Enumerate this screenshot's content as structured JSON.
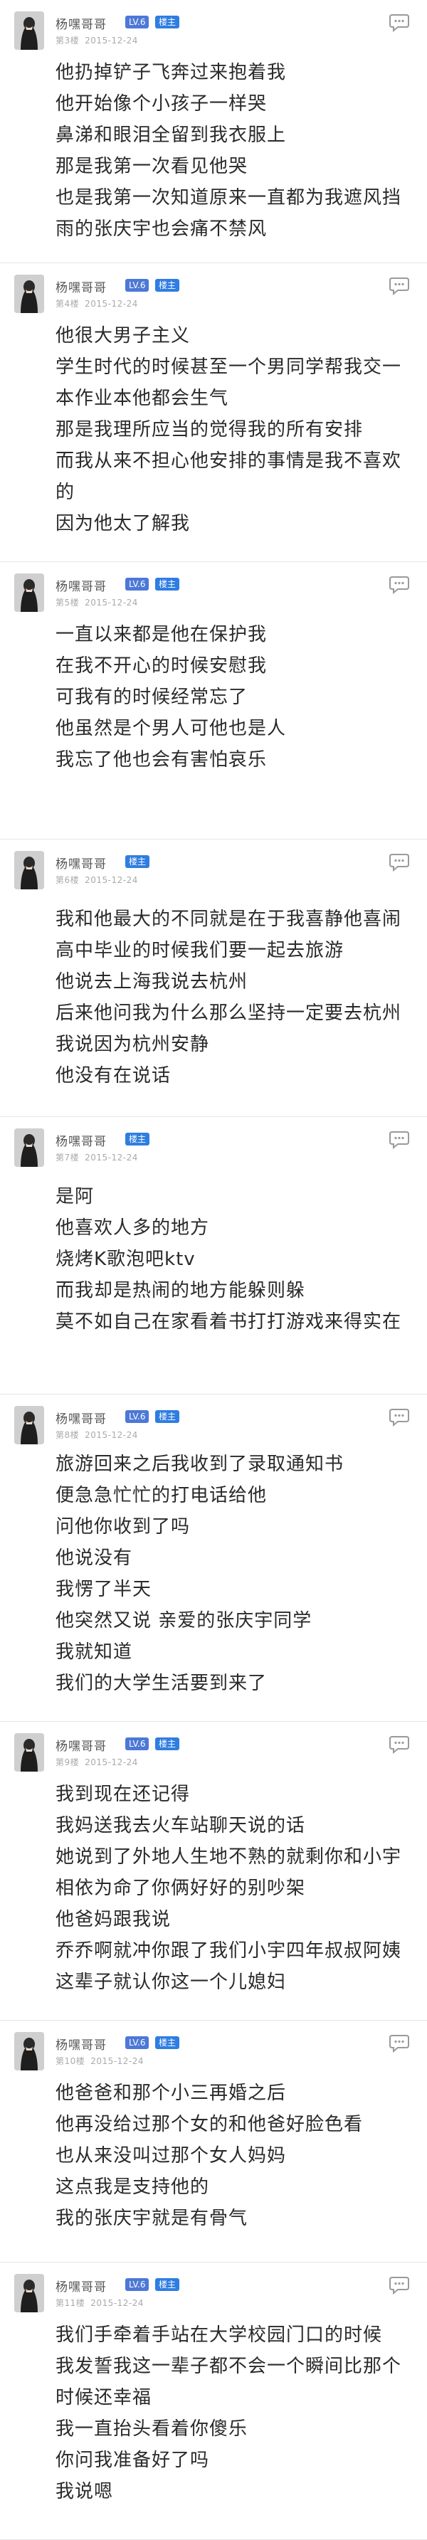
{
  "posts": [
    {
      "username": "杨嘿哥哥",
      "level_badge": "LV.6",
      "op_badge": "楼主",
      "floor": "第3楼",
      "date": "2015-12-24",
      "lines": [
        "他扔掉铲子飞奔过来抱着我",
        "他开始像个小孩子一样哭",
        "鼻涕和眼泪全留到我衣服上",
        "那是我第一次看见他哭",
        "也是我第一次知道原来一直都为我遮风挡",
        "雨的张庆宇也会痛不禁风"
      ]
    },
    {
      "username": "杨嘿哥哥",
      "level_badge": "LV.6",
      "op_badge": "楼主",
      "floor": "第4楼",
      "date": "2015-12-24",
      "lines": [
        "他很大男子主义",
        "学生时代的时候甚至一个男同学帮我交一",
        "本作业本他都会生气",
        "那是我理所应当的觉得我的所有安排",
        "而我从来不担心他安排的事情是我不喜欢",
        "的",
        "因为他太了解我"
      ]
    },
    {
      "username": "杨嘿哥哥",
      "level_badge": "LV.6",
      "op_badge": "楼主",
      "floor": "第5楼",
      "date": "2015-12-24",
      "lines": [
        "一直以来都是他在保护我",
        "在我不开心的时候安慰我",
        "可我有的时候经常忘了",
        "他虽然是个男人可他也是人",
        "我忘了他也会有害怕哀乐"
      ]
    },
    {
      "username": "杨嘿哥哥",
      "level_badge": "",
      "op_badge": "楼主",
      "floor": "第6楼",
      "date": "2015-12-24",
      "lines": [
        "我和他最大的不同就是在于我喜静他喜闹",
        "高中毕业的时候我们要一起去旅游",
        "他说去上海我说去杭州",
        "后来他问我为什么那么坚持一定要去杭州",
        "我说因为杭州安静",
        "他没有在说话"
      ]
    },
    {
      "username": "杨嘿哥哥",
      "level_badge": "",
      "op_badge": "楼主",
      "floor": "第7楼",
      "date": "2015-12-24",
      "lines": [
        "是阿",
        "他喜欢人多的地方",
        "烧烤K歌泡吧ktv",
        "而我却是热闹的地方能躲则躲",
        "莫不如自己在家看着书打打游戏来得实在"
      ]
    },
    {
      "username": "杨嘿哥哥",
      "level_badge": "LV.6",
      "op_badge": "楼主",
      "floor": "第8楼",
      "date": "2015-12-24",
      "lines": [
        "旅游回来之后我收到了录取通知书",
        "便急急忙忙的打电话给他",
        "问他你收到了吗",
        "他说没有",
        "我愣了半天",
        "他突然又说 亲爱的张庆宇同学",
        "我就知道",
        "我们的大学生活要到来了"
      ]
    },
    {
      "username": "杨嘿哥哥",
      "level_badge": "LV.6",
      "op_badge": "楼主",
      "floor": "第9楼",
      "date": "2015-12-24",
      "lines": [
        "我到现在还记得",
        "我妈送我去火车站聊天说的话",
        "她说到了外地人生地不熟的就剩你和小宇",
        "相依为命了你俩好好的别吵架",
        "他爸妈跟我说",
        "乔乔啊就冲你跟了我们小宇四年叔叔阿姨",
        "这辈子就认你这一个儿媳妇"
      ]
    },
    {
      "username": "杨嘿哥哥",
      "level_badge": "LV.6",
      "op_badge": "楼主",
      "floor": "第10楼",
      "date": "2015-12-24",
      "lines": [
        "他爸爸和那个小三再婚之后",
        "他再没给过那个女的和他爸好脸色看",
        "也从来没叫过那个女人妈妈",
        "这点我是支持他的",
        "我的张庆宇就是有骨气"
      ]
    },
    {
      "username": "杨嘿哥哥",
      "level_badge": "LV.6",
      "op_badge": "楼主",
      "floor": "第11楼",
      "date": "2015-12-24",
      "lines": [
        "我们手牵着手站在大学校园门口的时候",
        "我发誓我这一辈子都不会一个瞬间比那个",
        "时候还幸福",
        "我一直抬头看着你傻乐",
        "你问我准备好了吗",
        "我说嗯"
      ]
    }
  ]
}
